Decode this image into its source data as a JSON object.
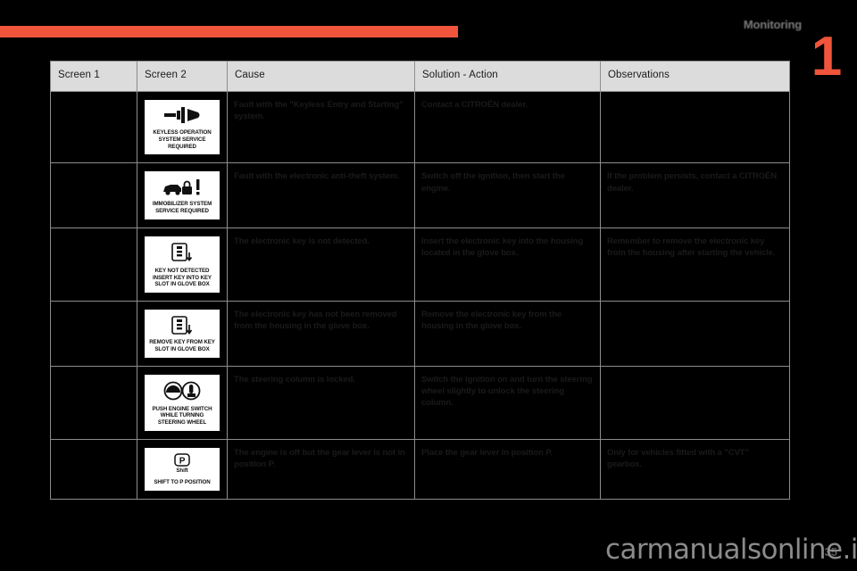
{
  "page": {
    "section_title": "Monitoring",
    "chapter_number": "1",
    "folio": "35",
    "watermark": "carmanualsonline.info",
    "accent_color": "#f0553c",
    "header_bg": "#dcdcdc"
  },
  "table": {
    "headers": [
      "Screen 1",
      "Screen 2",
      "Cause",
      "Solution - Action",
      "Observations"
    ],
    "rows": [
      {
        "screen1": "",
        "screen2": {
          "icon": "keyless-key-icon",
          "caption": "KEYLESS OPERATION SYSTEM SERVICE REQUIRED"
        },
        "cause": "Fault with the \"Keyless Entry and Starting\" system.",
        "solution": "Contact a CITROËN dealer.",
        "observations": ""
      },
      {
        "screen1": "",
        "screen2": {
          "icon": "immobilizer-car-lock-icon",
          "caption": "IMMOBILIZER SYSTEM SERVICE REQUIRED"
        },
        "cause": "Fault with the electronic anti-theft system.",
        "solution": "Switch off the ignition, then start the engine.",
        "observations": "If the problem persists, contact a CITROËN dealer."
      },
      {
        "screen1": "",
        "screen2": {
          "icon": "key-insert-icon",
          "caption": "KEY NOT DETECTED INSERT KEY INTO KEY SLOT IN GLOVE BOX"
        },
        "cause": "The electronic key is not detected.",
        "solution": "Insert the electronic key into the housing located in the glove box.",
        "observations": "Remember to remove the electronic key from the housing after starting the vehicle."
      },
      {
        "screen1": "",
        "screen2": {
          "icon": "key-remove-icon",
          "caption": "REMOVE KEY FROM KEY SLOT IN GLOVE BOX"
        },
        "cause": "The electronic key has not been removed from the housing in the glove box.",
        "solution": "Remove the electronic key from the housing in the glove box.",
        "observations": ""
      },
      {
        "screen1": "",
        "screen2": {
          "icon": "steering-wheel-push-switch-icon",
          "caption": "PUSH ENGINE SWITCH WHILE TURNING STEERING WHEEL"
        },
        "cause": "The steering column is locked.",
        "solution": "Switch the ignition on and turn the steering wheel slightly to unlock the steering column.",
        "observations": ""
      },
      {
        "screen1": "",
        "screen2": {
          "icon": "shift-to-p-icon",
          "caption": "SHIFT TO P POSITION",
          "badge_letter": "P",
          "badge_sub": "Shift"
        },
        "cause": "The engine is off but the gear lever is not in position P.",
        "solution": "Place the gear lever in position P.",
        "observations": "Only for vehicles fitted with a \"CVT\" gearbox."
      }
    ]
  }
}
